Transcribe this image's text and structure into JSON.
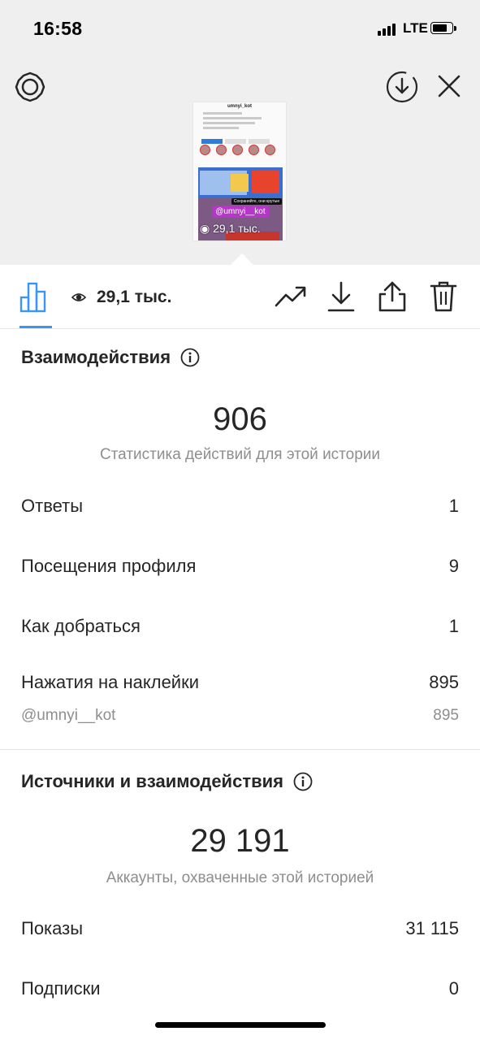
{
  "status_bar": {
    "time": "16:58",
    "carrier": "LTE"
  },
  "story_preview": {
    "username": "umnyi_kot",
    "sticker_black": "Сохраняйте, они крутые",
    "sticker_handle": "@umnyi__kot",
    "views": "29,1 тыс."
  },
  "toolbar": {
    "views": "29,1 тыс."
  },
  "interactions": {
    "title": "Взаимодействия",
    "total": "906",
    "caption": "Статистика действий для этой истории",
    "rows": [
      {
        "label": "Ответы",
        "value": "1"
      },
      {
        "label": "Посещения профиля",
        "value": "9"
      },
      {
        "label": "Как добраться",
        "value": "1"
      },
      {
        "label": "Нажатия на наклейки",
        "value": "895"
      }
    ],
    "sub_row": {
      "label": "@umnyi__kot",
      "value": "895"
    }
  },
  "discovery": {
    "title": "Источники и взаимодействия",
    "total": "29 191",
    "caption": "Аккаунты, охваченные этой историей",
    "rows": [
      {
        "label": "Показы",
        "value": "31 115"
      },
      {
        "label": "Подписки",
        "value": "0"
      }
    ]
  },
  "colors": {
    "accent": "#3897f0",
    "background_top": "#efefef",
    "text": "#262626",
    "secondary": "#8e8e8e"
  },
  "icons": [
    "settings-icon",
    "download-circle-icon",
    "close-icon",
    "bar-chart-icon",
    "eye-icon",
    "trend-icon",
    "download-icon",
    "share-icon",
    "trash-icon",
    "info-icon"
  ]
}
